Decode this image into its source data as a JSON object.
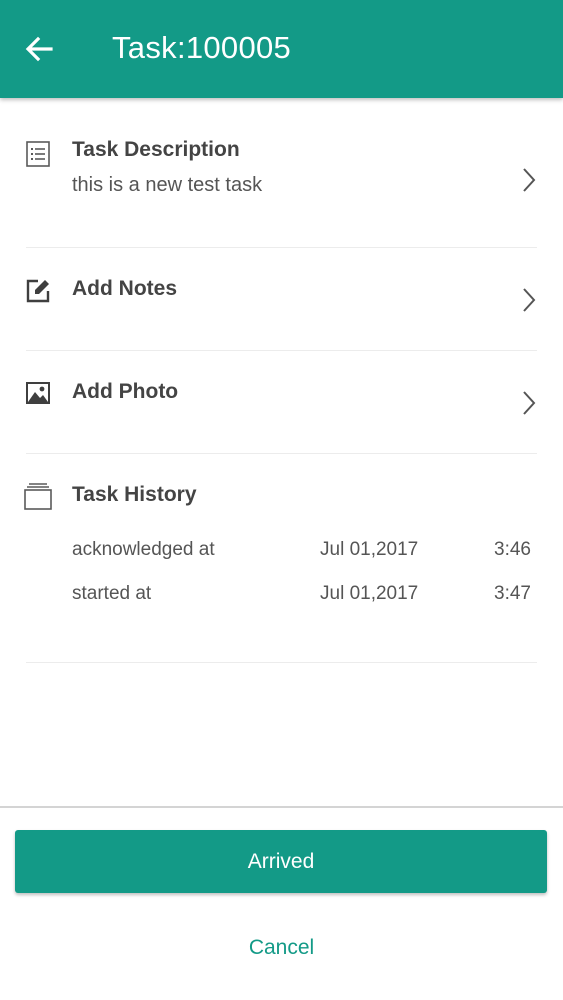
{
  "header": {
    "title": "Task:100005",
    "back_icon": "arrow-left-icon",
    "color": "#139a87"
  },
  "sections": {
    "description": {
      "title": "Task Description",
      "value": "this is a new test task",
      "icon": "list-icon"
    },
    "notes": {
      "title": "Add Notes",
      "icon": "edit-icon"
    },
    "photo": {
      "title": "Add Photo",
      "icon": "image-icon"
    },
    "history": {
      "title": "Task History",
      "icon": "history-icon",
      "entries": [
        {
          "label": "acknowledged at",
          "date": "Jul 01,2017",
          "time": "3:46"
        },
        {
          "label": "started at",
          "date": "Jul 01,2017",
          "time": "3:47"
        }
      ]
    }
  },
  "actions": {
    "primary_label": "Arrived",
    "secondary_label": "Cancel"
  }
}
